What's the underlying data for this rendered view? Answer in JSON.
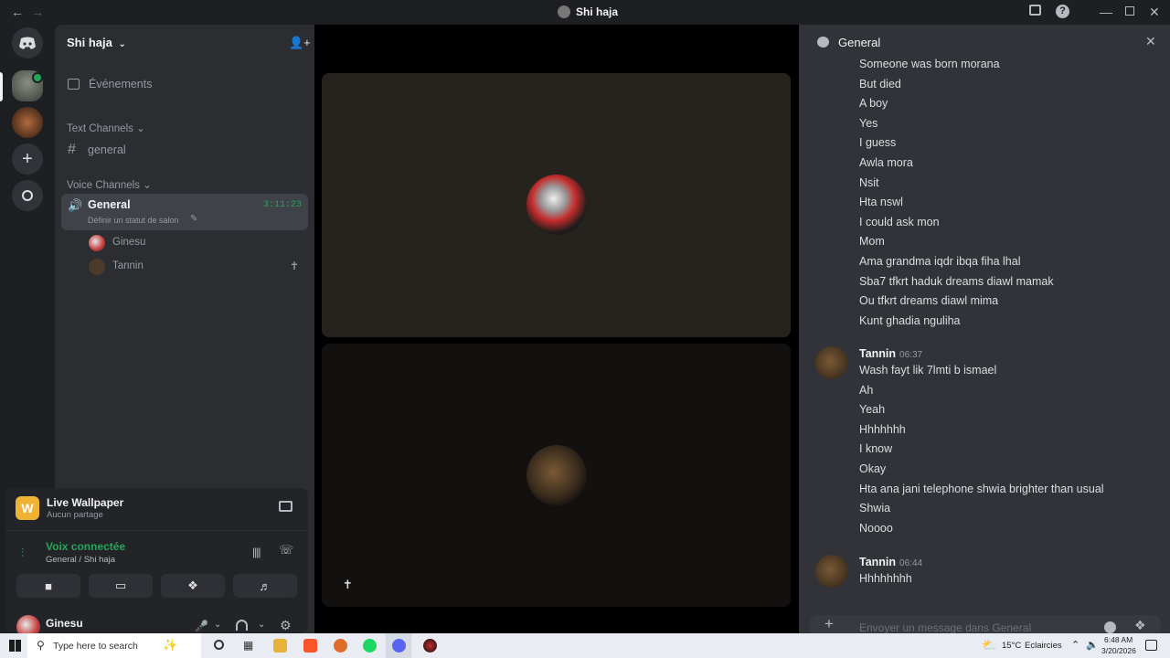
{
  "window": {
    "title": "Shi haja",
    "back_icon": "arrow-left",
    "forward_icon": "arrow-right"
  },
  "server": {
    "name": "Shi haja",
    "events_label": "Événements",
    "text_category": "Text Channels",
    "text_channel": "general",
    "voice_category": "Voice Channels",
    "voice_channel": "General",
    "voice_timer": "3:11:23",
    "voice_status_hint": "Définir un statut de salon",
    "voice_members": [
      {
        "name": "Ginesu"
      },
      {
        "name": "Tannin"
      }
    ]
  },
  "activity": {
    "title": "Live Wallpaper",
    "subtitle": "Aucun partage"
  },
  "voice_panel": {
    "status": "Voix connectée",
    "location": "General / Shi haja"
  },
  "user": {
    "name": "Ginesu"
  },
  "chat": {
    "channel": "General",
    "placeholder": "Envoyer un message dans General",
    "first_group": [
      "Someone was born morana",
      "But died",
      "A boy",
      "Yes",
      "I guess",
      "Awla mora",
      "Nsit",
      "Hta nswl",
      "I could ask mon",
      "Mom",
      "Ama grandma iqdr ibqa fiha lhal",
      "Sba7 tfkrt haduk dreams diawl mamak",
      "Ou tfkrt dreams diawl mima",
      "Kunt ghadia nguliha"
    ],
    "groups": [
      {
        "author": "Tannin",
        "time": "06:37",
        "lines": [
          "Wash fayt lik 7lmti b ismael",
          "Ah",
          "Yeah",
          "Hhhhhhh",
          "I know",
          "Okay",
          "Hta ana jani telephone shwia brighter than usual",
          "Shwia",
          "Noooo"
        ]
      },
      {
        "author": "Tannin",
        "time": "06:44",
        "lines": [
          "Hhhhhhhh"
        ]
      }
    ]
  },
  "taskbar": {
    "search_placeholder": "Type here to search",
    "weather": "15°C",
    "weather_desc": "Eclaircies",
    "time": "6:48 AM",
    "date": "3/20/2026"
  },
  "colors": {
    "accent_green": "#23a55a",
    "discord_blurple": "#5865f2",
    "bg_dark": "#1e1f22",
    "sidebar": "#2b2d31",
    "chat_bg": "#313338"
  }
}
